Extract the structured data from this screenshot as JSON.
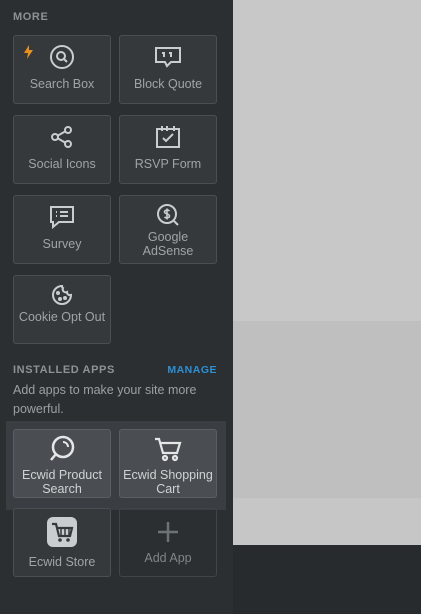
{
  "sections": {
    "more": "MORE",
    "installed": "INSTALLED APPS",
    "manage": "MANAGE"
  },
  "installed_desc": "Add apps to make your site more powerful.",
  "more_tiles": [
    {
      "label": "Search Box",
      "icon": "search-icon"
    },
    {
      "label": "Block Quote",
      "icon": "quote-icon"
    },
    {
      "label": "Social Icons",
      "icon": "share-icon"
    },
    {
      "label": "RSVP Form",
      "icon": "calendar-check-icon"
    },
    {
      "label": "Survey",
      "icon": "chat-list-icon"
    },
    {
      "label": "Google AdSense",
      "icon": "dollar-search-icon"
    },
    {
      "label": "Cookie Opt Out",
      "icon": "cookie-icon"
    }
  ],
  "app_tiles": [
    {
      "label": "Ecwid Product Search",
      "icon": "product-search-icon"
    },
    {
      "label": "Ecwid Shopping Cart",
      "icon": "cart-icon"
    },
    {
      "label": "Ecwid Store",
      "icon": "store-basket-icon"
    },
    {
      "label": "Add App",
      "icon": "plus-icon"
    }
  ],
  "colors": {
    "accent": "#2e8fd6",
    "bolt": "#e8901c",
    "sidebar": "#2b2f32",
    "canvas": "#c8c8c8"
  }
}
